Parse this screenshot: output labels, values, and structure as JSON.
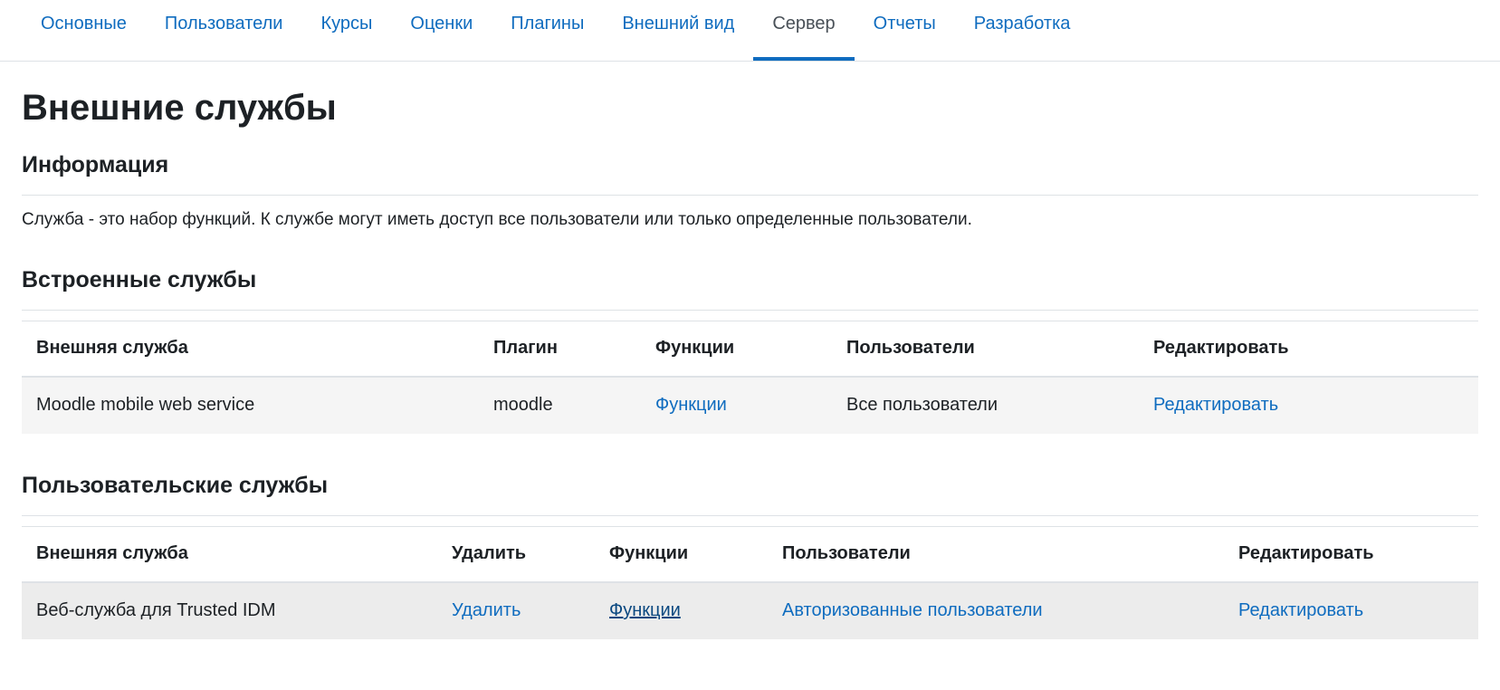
{
  "nav": {
    "tabs": [
      {
        "label": "Основные"
      },
      {
        "label": "Пользователи"
      },
      {
        "label": "Курсы"
      },
      {
        "label": "Оценки"
      },
      {
        "label": "Плагины"
      },
      {
        "label": "Внешний вид"
      },
      {
        "label": "Сервер"
      },
      {
        "label": "Отчеты"
      },
      {
        "label": "Разработка"
      }
    ],
    "active_tab": "Сервер"
  },
  "page": {
    "title": "Внешние службы"
  },
  "info": {
    "heading": "Информация",
    "text": "Служба - это набор функций. К службе могут иметь доступ все пользователи или только определенные пользователи."
  },
  "builtin": {
    "heading": "Встроенные службы",
    "columns": [
      "Внешняя служба",
      "Плагин",
      "Функции",
      "Пользователи",
      "Редактировать"
    ],
    "rows": [
      {
        "service": "Moodle mobile web service",
        "plugin": "moodle",
        "functions": "Функции",
        "users": "Все пользователи",
        "edit": "Редактировать"
      }
    ]
  },
  "custom": {
    "heading": "Пользовательские службы",
    "columns": [
      "Внешняя служба",
      "Удалить",
      "Функции",
      "Пользователи",
      "Редактировать"
    ],
    "rows": [
      {
        "service": "Веб-служба для Trusted IDM",
        "delete": "Удалить",
        "functions": "Функции",
        "users": "Авторизованные пользователи",
        "edit": "Редактировать"
      }
    ]
  },
  "colors": {
    "link": "#0f6cbf",
    "text": "#1d2125",
    "active_tab_text": "#495057",
    "row_stripe": "#f5f5f5"
  }
}
